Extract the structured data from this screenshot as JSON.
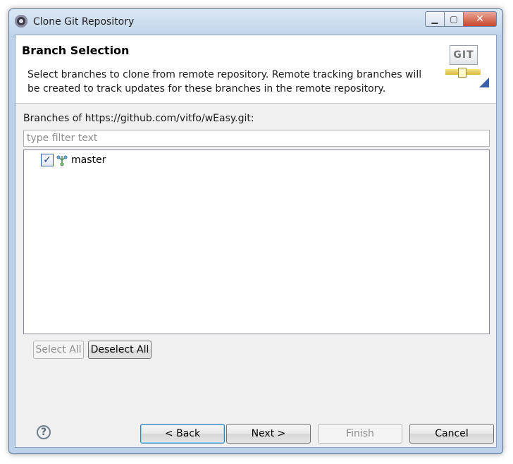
{
  "window": {
    "title": "Clone Git Repository"
  },
  "banner": {
    "title": "Branch Selection",
    "description": "Select branches to clone from remote repository. Remote tracking branches will be created to track updates for these branches in the remote repository.",
    "logo_text": "GIT"
  },
  "branches": {
    "label": "Branches of https://github.com/vitfo/wEasy.git:",
    "filter_placeholder": "type filter text",
    "items": [
      {
        "label": "master",
        "checked": true
      }
    ]
  },
  "selection_buttons": {
    "select_all": "Select All",
    "deselect_all": "Deselect All"
  },
  "footer": {
    "back": "< Back",
    "next": "Next >",
    "finish": "Finish",
    "cancel": "Cancel",
    "help_glyph": "?"
  },
  "icons": {
    "app": "eclipse-icon",
    "branch": "branch-icon",
    "help": "help-icon",
    "check": "check-icon"
  }
}
